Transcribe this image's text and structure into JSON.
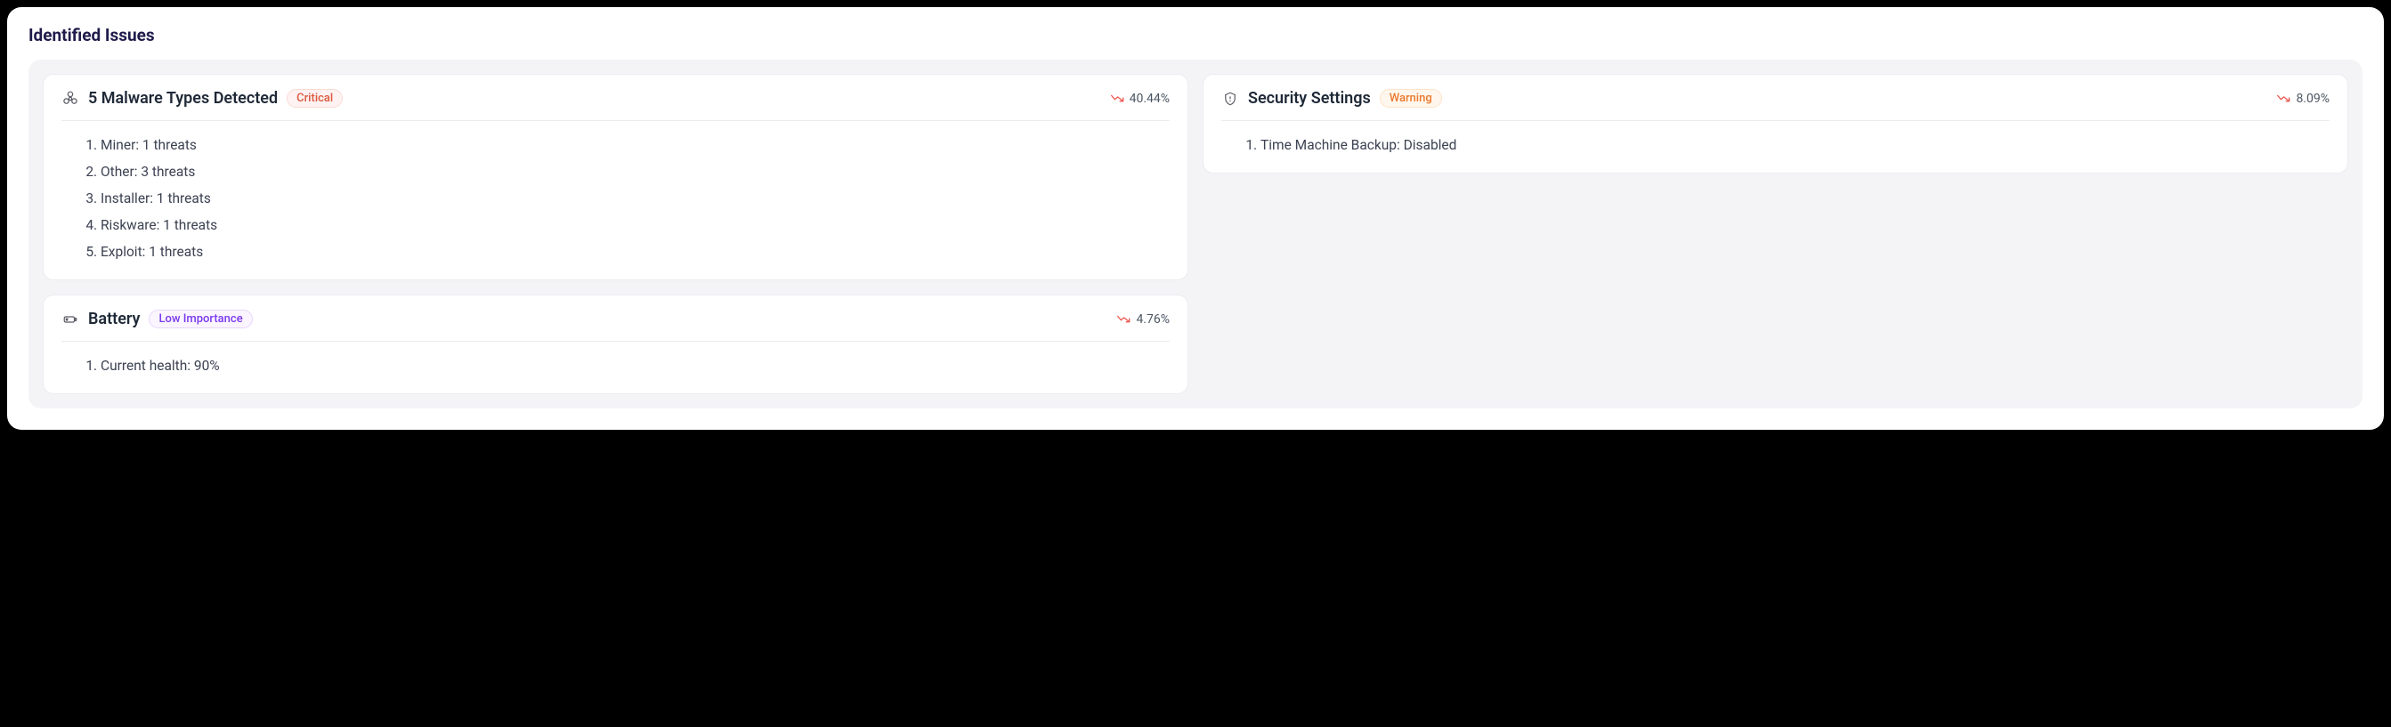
{
  "title": "Identified Issues",
  "cards": [
    {
      "icon": "biohazard-icon",
      "title": "5 Malware Types Detected",
      "badge": {
        "label": "Critical",
        "variant": "critical"
      },
      "trend": "40.44%",
      "items": [
        "Miner: 1 threats",
        "Other: 3 threats",
        "Installer: 1 threats",
        "Riskware: 1 threats",
        "Exploit: 1 threats"
      ]
    },
    {
      "icon": "shield-icon",
      "title": "Security Settings",
      "badge": {
        "label": "Warning",
        "variant": "warning"
      },
      "trend": "8.09%",
      "items": [
        "Time Machine Backup: Disabled"
      ]
    },
    {
      "icon": "battery-icon",
      "title": "Battery",
      "badge": {
        "label": "Low Importance",
        "variant": "low"
      },
      "trend": "4.76%",
      "items": [
        "Current health: 90%"
      ]
    }
  ]
}
